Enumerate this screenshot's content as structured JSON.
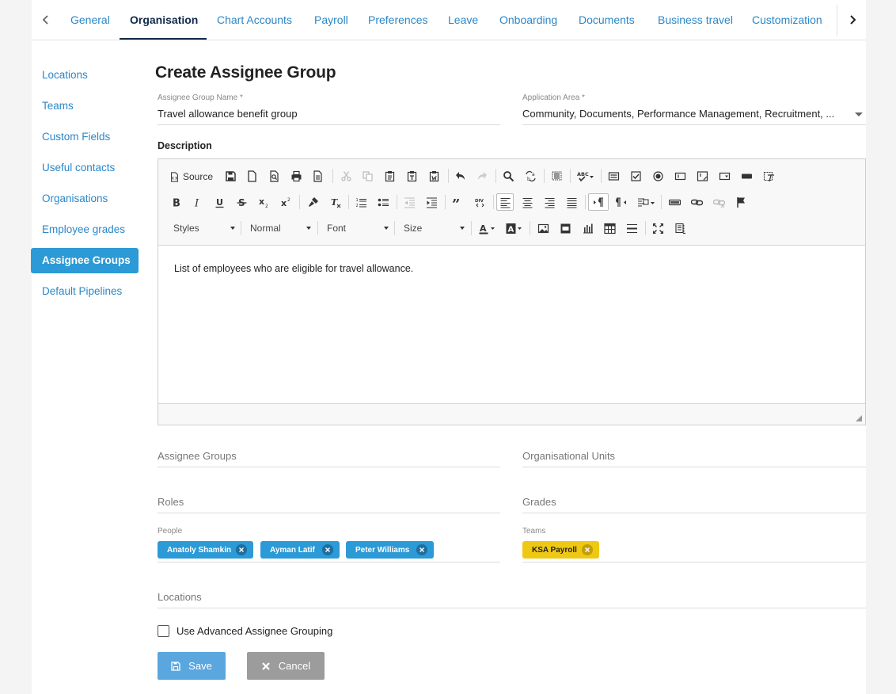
{
  "tabs": {
    "items": [
      "General",
      "Organisation",
      "Chart Accounts",
      "Payroll",
      "Preferences",
      "Leave",
      "Onboarding",
      "Documents",
      "Business travel",
      "Customization"
    ],
    "active": "Organisation"
  },
  "sidebar": {
    "items": [
      "Locations",
      "Teams",
      "Custom Fields",
      "Useful contacts",
      "Organisations",
      "Employee grades",
      "Assignee Groups",
      "Default Pipelines"
    ],
    "active": "Assignee Groups"
  },
  "page": {
    "title": "Create Assignee Group"
  },
  "form": {
    "name_label": "Assignee Group Name *",
    "name_value": "Travel allowance benefit group",
    "area_label": "Application Area *",
    "area_value": "Community, Documents, Performance Management, Recruitment, ...",
    "description_label": "Description"
  },
  "editor": {
    "source_label": "Source",
    "styles_label": "Styles",
    "format_label": "Normal",
    "font_label": "Font",
    "size_label": "Size",
    "content": "List of employees who are eligible for travel allowance."
  },
  "sections": {
    "assignee_groups": "Assignee Groups",
    "org_units": "Organisational Units",
    "roles": "Roles",
    "grades": "Grades",
    "people_label": "People",
    "teams_label": "Teams",
    "locations": "Locations"
  },
  "people": [
    "Anatoly Shamkin",
    "Ayman Latif",
    "Peter Williams"
  ],
  "teams": [
    "KSA Payroll"
  ],
  "advanced": {
    "label": "Use Advanced Assignee Grouping",
    "checked": false
  },
  "buttons": {
    "save": "Save",
    "cancel": "Cancel"
  },
  "colors": {
    "accent": "#2b9ad6",
    "nav_dark": "#12294a",
    "chip_yellow": "#efc814"
  }
}
